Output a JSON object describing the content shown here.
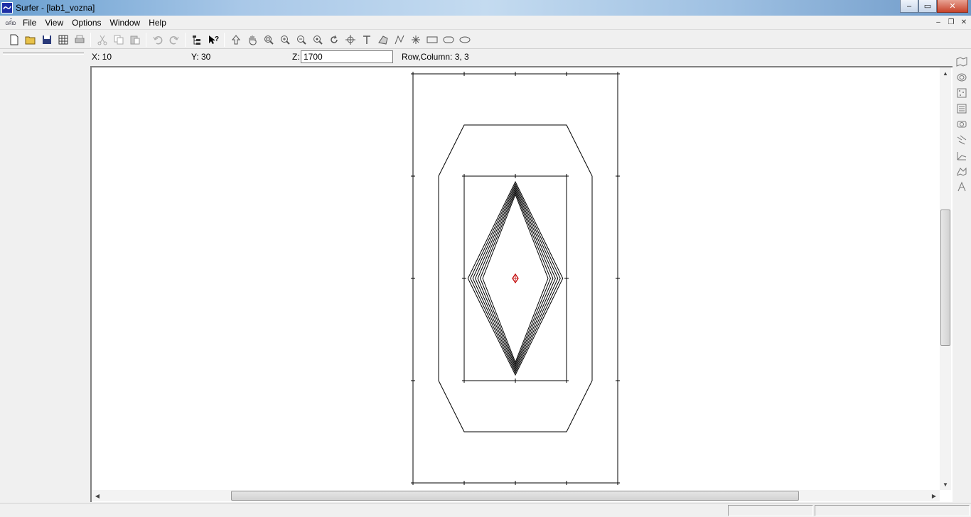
{
  "window": {
    "title": "Surfer - [lab1_vozna]",
    "min": "–",
    "max": "▭",
    "close": "✕"
  },
  "menu": {
    "grid_label": "GRID",
    "items": [
      "File",
      "View",
      "Options",
      "Window",
      "Help"
    ]
  },
  "mdi": {
    "min": "–",
    "restore": "❐",
    "close": "✕"
  },
  "coords": {
    "x_label": "X: 10",
    "y_label": "Y: 30",
    "z_label": "Z:",
    "z_value": "1700",
    "rowcol_label": "Row,Column:  3, 3"
  },
  "toolbar_icons": [
    "new-icon",
    "open-icon",
    "save-icon",
    "worksheet-icon",
    "print-icon",
    "cut-icon",
    "copy-icon",
    "paste-icon",
    "undo-icon",
    "redo-icon",
    "object-manager-icon",
    "context-help-icon",
    "select-icon",
    "pan-icon",
    "zoom-rectangle-icon",
    "zoom-in-icon",
    "zoom-out-icon",
    "zoom-fit-icon",
    "rotate-icon",
    "node-icon",
    "text-icon",
    "polygon-icon",
    "polyline-icon",
    "symbol-icon",
    "rectangle-icon",
    "rounded-rectangle-icon",
    "ellipse-icon"
  ],
  "right_toolbar_icons": [
    "map-icon",
    "contour-map-icon",
    "post-map-icon",
    "classed-post-icon",
    "image-map-icon",
    "vector-map-icon",
    "wireframe-icon",
    "surface-icon",
    "variogram-icon"
  ],
  "colors": {
    "canvas": "#ffffff",
    "center_marker": "#c00000",
    "lines": "#000000"
  }
}
